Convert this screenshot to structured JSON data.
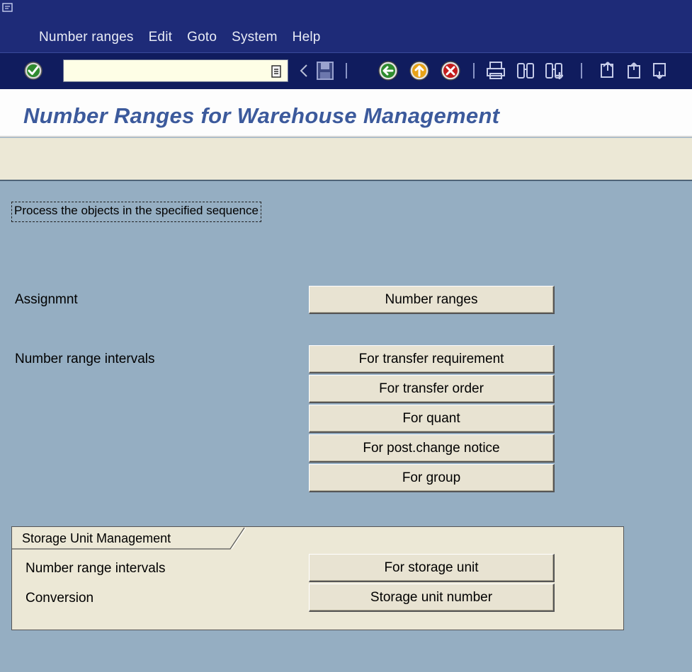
{
  "menu": {
    "items": [
      {
        "label": "Number ranges"
      },
      {
        "label": "Edit"
      },
      {
        "label": "Goto"
      },
      {
        "label": "System"
      },
      {
        "label": "Help"
      }
    ]
  },
  "toolbar": {
    "command_field_value": "",
    "icons": [
      "enter-check-icon",
      "command-history-icon",
      "collapse-arrow-icon",
      "save-icon",
      "back-icon",
      "exit-icon",
      "cancel-icon",
      "print-icon",
      "find-icon",
      "find-next-icon",
      "first-page-icon",
      "previous-page-icon",
      "next-page-icon"
    ]
  },
  "page": {
    "title": "Number Ranges for Warehouse Management",
    "hint": "Process the objects in the specified sequence"
  },
  "sections": {
    "assignment_label": "Assignmnt",
    "assignment_button": "Number ranges",
    "intervals_label": "Number range intervals",
    "interval_buttons": [
      "For transfer requirement",
      "For transfer order",
      "For quant",
      "For post.change notice",
      "For group"
    ]
  },
  "storage_unit": {
    "group_title": "Storage Unit Management",
    "intervals_label": "Number range intervals",
    "intervals_button": "For storage unit",
    "conversion_label": "Conversion",
    "conversion_button": "Storage unit number"
  },
  "colors": {
    "menubar_bg": "#1e2b78",
    "toolbar_bg": "#101c5e",
    "title_color": "#3c5a9c",
    "workarea_bg": "#95aec2",
    "button_bg": "#e8e3d2",
    "group_bg": "#ece8d6"
  }
}
